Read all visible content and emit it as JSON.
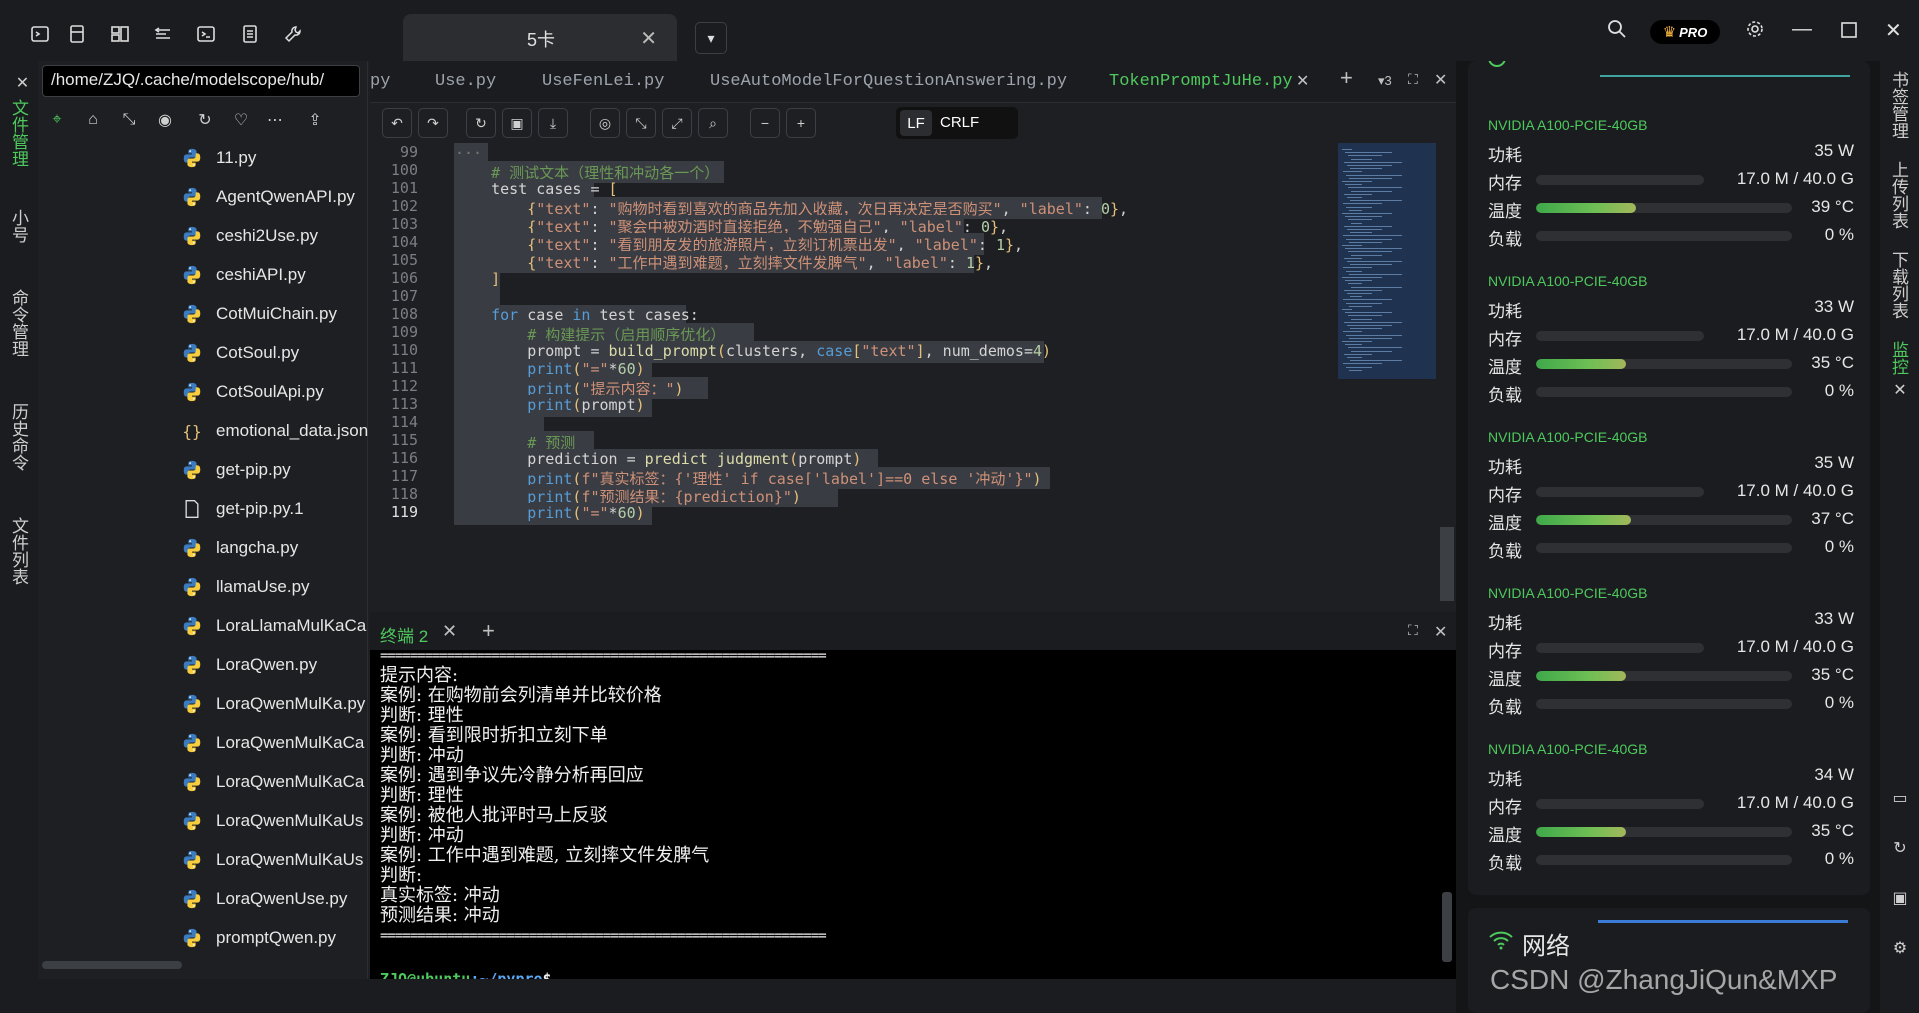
{
  "titlebar": {
    "session_tab_label": "5卡",
    "pro_badge": "PRO"
  },
  "left_sidebar": {
    "labels": [
      "文件管理",
      "小号",
      "命令管理",
      "历史命令",
      "文件列表"
    ],
    "active_index": 0
  },
  "filetree": {
    "path": "/home/ZJQ/.cache/modelscope/hub/",
    "files": [
      {
        "name": "11.py",
        "type": "python"
      },
      {
        "name": "AgentQwenAPI.py",
        "type": "python"
      },
      {
        "name": "ceshi2Use.py",
        "type": "python"
      },
      {
        "name": "ceshiAPI.py",
        "type": "python"
      },
      {
        "name": "CotMuiChain.py",
        "type": "python"
      },
      {
        "name": "CotSoul.py",
        "type": "python"
      },
      {
        "name": "CotSoulApi.py",
        "type": "python"
      },
      {
        "name": "emotional_data.json",
        "type": "json"
      },
      {
        "name": "get-pip.py",
        "type": "python"
      },
      {
        "name": "get-pip.py.1",
        "type": "file"
      },
      {
        "name": "langcha.py",
        "type": "python"
      },
      {
        "name": "llamaUse.py",
        "type": "python"
      },
      {
        "name": "LoraLlamaMulKaCa",
        "type": "python"
      },
      {
        "name": "LoraQwen.py",
        "type": "python"
      },
      {
        "name": "LoraQwenMulKa.py",
        "type": "python"
      },
      {
        "name": "LoraQwenMulKaCa",
        "type": "python"
      },
      {
        "name": "LoraQwenMulKaCa",
        "type": "python"
      },
      {
        "name": "LoraQwenMulKaUs",
        "type": "python"
      },
      {
        "name": "LoraQwenMulKaUs",
        "type": "python"
      },
      {
        "name": "LoraQwenUse.py",
        "type": "python"
      },
      {
        "name": "promptQwen.py",
        "type": "python"
      }
    ]
  },
  "editor": {
    "tabs": [
      {
        "label": "py",
        "active": false
      },
      {
        "label": "Use.py",
        "active": false
      },
      {
        "label": "UseFenLei.py",
        "active": false
      },
      {
        "label": "UseAutoModelForQuestionAnswering.py",
        "active": false
      },
      {
        "label": "TokenPromptJuHe.py",
        "active": true
      }
    ],
    "tab_count": "3",
    "eol_lf": "LF",
    "eol_crlf": "CRLF",
    "current_line": 119
  },
  "terminal": {
    "tab_label": "终端 2",
    "separator": "============================================================",
    "lines": [
      "提示内容:",
      "案例: 在购物前会列清单并比较价格",
      "判断: 理性",
      "案例: 看到限时折扣立刻下单",
      "判断: 冲动",
      "案例: 遇到争议先冷静分析再回应",
      "判断: 理性",
      "案例: 被他人批评时马上反驳",
      "判断: 冲动",
      "案例: 工作中遇到难题, 立刻摔文件发脾气",
      "判断:",
      "真实标签: 冲动",
      "预测结果: 冲动"
    ],
    "prompt_user": "ZJQ@ubuntu",
    "prompt_path": ":~/pypro",
    "prompt_symbol": "$"
  },
  "monitor": {
    "gpus": [
      {
        "name": "NVIDIA A100-PCIE-40GB",
        "power": "35 W",
        "memory": "17.0 M / 40.0 G",
        "temp": "39 °C",
        "load": "0 %",
        "temp_fill": 0.39,
        "mem_fill": 0.0004
      },
      {
        "name": "NVIDIA A100-PCIE-40GB",
        "power": "33 W",
        "memory": "17.0 M / 40.0 G",
        "temp": "35 °C",
        "load": "0 %",
        "temp_fill": 0.35,
        "mem_fill": 0.0004
      },
      {
        "name": "NVIDIA A100-PCIE-40GB",
        "power": "35 W",
        "memory": "17.0 M / 40.0 G",
        "temp": "37 °C",
        "load": "0 %",
        "temp_fill": 0.37,
        "mem_fill": 0.0004
      },
      {
        "name": "NVIDIA A100-PCIE-40GB",
        "power": "33 W",
        "memory": "17.0 M / 40.0 G",
        "temp": "35 °C",
        "load": "0 %",
        "temp_fill": 0.35,
        "mem_fill": 0.0004
      },
      {
        "name": "NVIDIA A100-PCIE-40GB",
        "power": "34 W",
        "memory": "17.0 M / 40.0 G",
        "temp": "35 °C",
        "load": "0 %",
        "temp_fill": 0.35,
        "mem_fill": 0.0004
      }
    ],
    "row_labels": {
      "power": "功耗",
      "memory": "内存",
      "temp": "温度",
      "load": "负载"
    },
    "network_label": "网络",
    "watermark": "CSDN @ZhangJiQun&MXP"
  },
  "right_sidebar": {
    "labels": [
      "书签管理",
      "上传列表",
      "下载列表",
      "监控"
    ],
    "active_index": 3
  },
  "colors": {
    "accent": "#4ec95e",
    "background": "#1e1f22",
    "terminal_bg": "#000000"
  }
}
